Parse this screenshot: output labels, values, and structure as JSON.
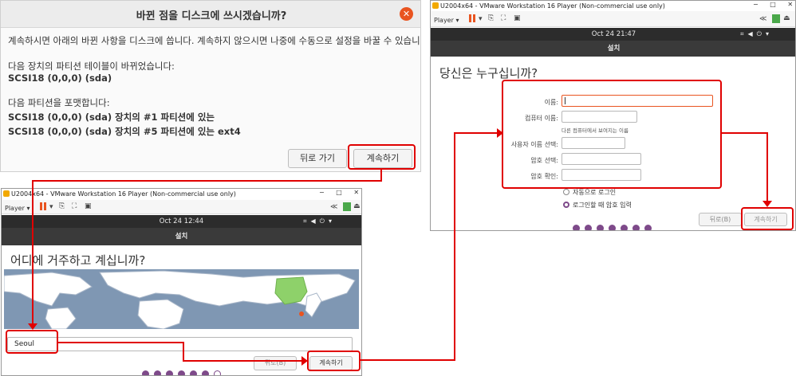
{
  "dialog": {
    "title": "바뀐 점을 디스크에 쓰시겠습니까?",
    "close_glyph": "✕",
    "intro": "계속하시면 아래의 바뀐 사항을 디스크에 씁니다. 계속하지 않으시면 나중에 수동으로 설정을 바꿀 수 있습니다.",
    "partition_heading": "다음 장치의 파티션 테이블이 바뀌었습니다:",
    "partition_device": "SCSI18 (0,0,0) (sda)",
    "format_heading": "다음 파티션을 포맷합니다:",
    "format_items": [
      "SCSI18 (0,0,0) (sda) 장치의 #1 파티션에 있는",
      "SCSI18 (0,0,0) (sda) 장치의 #5 파티션에 있는 ext4"
    ],
    "back_label": "뒤로 가기",
    "continue_label": "계속하기"
  },
  "vm1": {
    "window_title": "U2004x64 - VMware Workstation 16 Player (Non-commercial use only)",
    "player_label": "Player",
    "clock": "Oct 24  12:44",
    "header": "설치",
    "heading": "어디에 거주하고 계십니까?",
    "location_value": "Seoul",
    "back_label": "뒤로(B)",
    "continue_label": "계속하기",
    "progress_filled": 6,
    "progress_total": 7
  },
  "vm2": {
    "window_title": "U2004x64 - VMware Workstation 16 Player (Non-commercial use only)",
    "player_label": "Player",
    "clock": "Oct 24  21:47",
    "header": "설치",
    "heading": "당신은 누구십니까?",
    "name_label": "이름:",
    "computer_label": "컴퓨터 이름:",
    "computer_hint": "다른 컴퓨터에서 보여지는 이름",
    "username_label": "사용자 이름 선택:",
    "password_label": "암호 선택:",
    "confirm_label": "암호 확인:",
    "auto_login": "자동으로 로그인",
    "require_password": "로그인할 때 암호 입력",
    "back_label": "뒤로(B)",
    "continue_label": "계속하기",
    "progress_filled": 7,
    "progress_total": 7
  },
  "colors": {
    "accent": "#e95420",
    "highlight": "#e00000",
    "progress": "#7e4a8a",
    "land": "#ffffff",
    "sea": "#7f97b3",
    "selected_zone": "#8ed16a"
  },
  "icons": [
    "close-icon",
    "pause-icon",
    "send-keys-icon",
    "fit-icon",
    "fullscreen-icon",
    "network-icon",
    "volume-icon",
    "power-icon",
    "collapse-icon",
    "menu-icon"
  ]
}
